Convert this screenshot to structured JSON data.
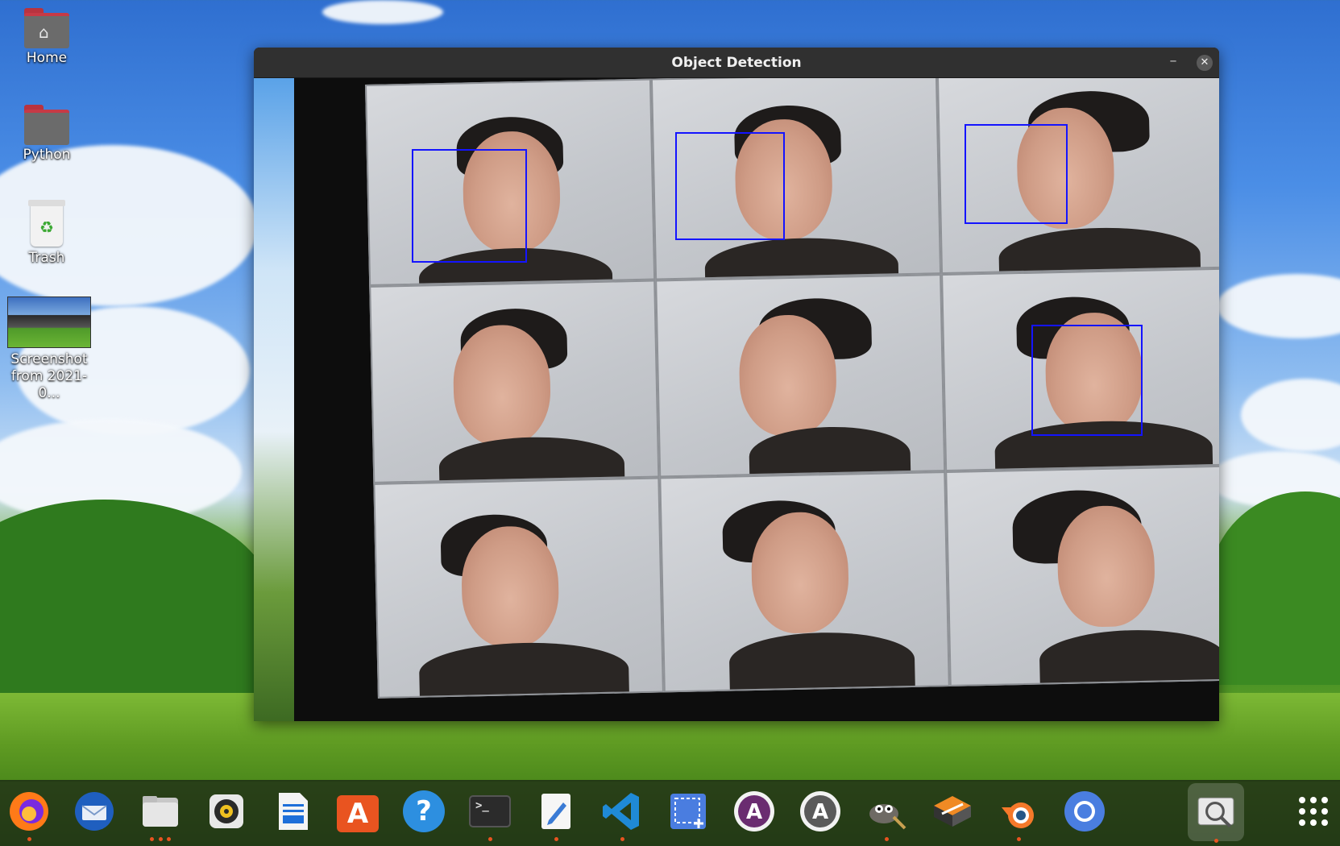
{
  "desktop": {
    "icons": [
      {
        "label": "Home"
      },
      {
        "label": "Python"
      },
      {
        "label": "Trash"
      },
      {
        "label": "Screenshot from 2021-0..."
      }
    ]
  },
  "window": {
    "title": "Object Detection",
    "minimize_glyph": "–",
    "close_glyph": "✕",
    "detections_count": 4
  },
  "dock": {
    "items": [
      {
        "name": "firefox-icon",
        "running": true
      },
      {
        "name": "thunderbird-icon",
        "running": false
      },
      {
        "name": "files-icon",
        "running": true
      },
      {
        "name": "rhythmbox-icon",
        "running": false
      },
      {
        "name": "libreoffice-writer-icon",
        "running": false
      },
      {
        "name": "software-center-icon",
        "running": false
      },
      {
        "name": "help-icon",
        "running": false
      },
      {
        "name": "terminal-icon",
        "running": true
      },
      {
        "name": "text-editor-icon",
        "running": true
      },
      {
        "name": "vscode-icon",
        "running": true
      },
      {
        "name": "screenshot-tool-icon",
        "running": false
      },
      {
        "name": "anaconda-navigator-icon",
        "running": false
      },
      {
        "name": "anaconda-icon",
        "running": false
      },
      {
        "name": "gimp-icon",
        "running": true
      },
      {
        "name": "sublime-merge-icon",
        "running": false
      },
      {
        "name": "blender-icon",
        "running": true
      },
      {
        "name": "chromium-icon",
        "running": false
      },
      {
        "name": "image-viewer-icon",
        "running": true
      },
      {
        "name": "show-applications-icon",
        "running": false
      }
    ],
    "terminal_glyph": ">_",
    "help_glyph": "?",
    "store_glyph": "A"
  },
  "colors": {
    "bbox": "#1414ff",
    "accent": "#e95420",
    "titlebar": "#303030"
  }
}
